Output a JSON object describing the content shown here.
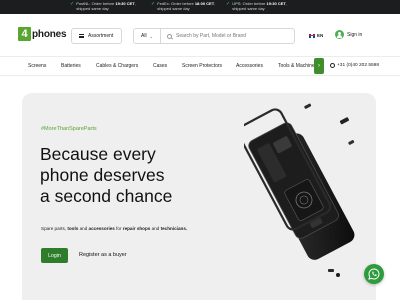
{
  "shipping": [
    {
      "carrier": "PostNL:",
      "text_pre": "Order before",
      "time": "19:30 CET",
      "text_post": ", shipped same day"
    },
    {
      "carrier": "FedEx:",
      "text_pre": "Order before",
      "time": "18:00 CET",
      "text_post": ", shipped same day"
    },
    {
      "carrier": "UPS:",
      "text_pre": "Order before",
      "time": "19:30 CET",
      "text_post": ", shipped same day"
    }
  ],
  "header": {
    "logo_mark": "4",
    "logo_text": "phones",
    "assortment_label": "Assortment",
    "search_category": "All",
    "search_placeholder": "Search by Part, Model or Brand",
    "language": "EN",
    "signin_label": "Sign in"
  },
  "nav": {
    "categories": [
      "Screens",
      "Batteries",
      "Cables & Chargers",
      "Cases",
      "Screen Protectors",
      "Accessories",
      "Tools & Machines"
    ],
    "phone": "+31 (0)40 202 5598"
  },
  "hero": {
    "tag": "#MoreThanSpareParts",
    "headline": [
      "Because every",
      "phone deserves",
      "a second chance"
    ],
    "sub_pre": "Spare parts,",
    "sub_tools": "tools",
    "sub_and1": "and",
    "sub_accessories": "accessories",
    "sub_for": "for",
    "sub_repair": "repair shops",
    "sub_and2": "and",
    "sub_tech": "technicians.",
    "login_label": "Login",
    "buyer_label": "Register as a buyer"
  },
  "colors": {
    "brand_green": "#58a630",
    "button_green": "#2f7d2a",
    "whatsapp_green": "#2e9b3e",
    "topbar": "#1b1d1f",
    "hero_bg": "#efefef"
  }
}
